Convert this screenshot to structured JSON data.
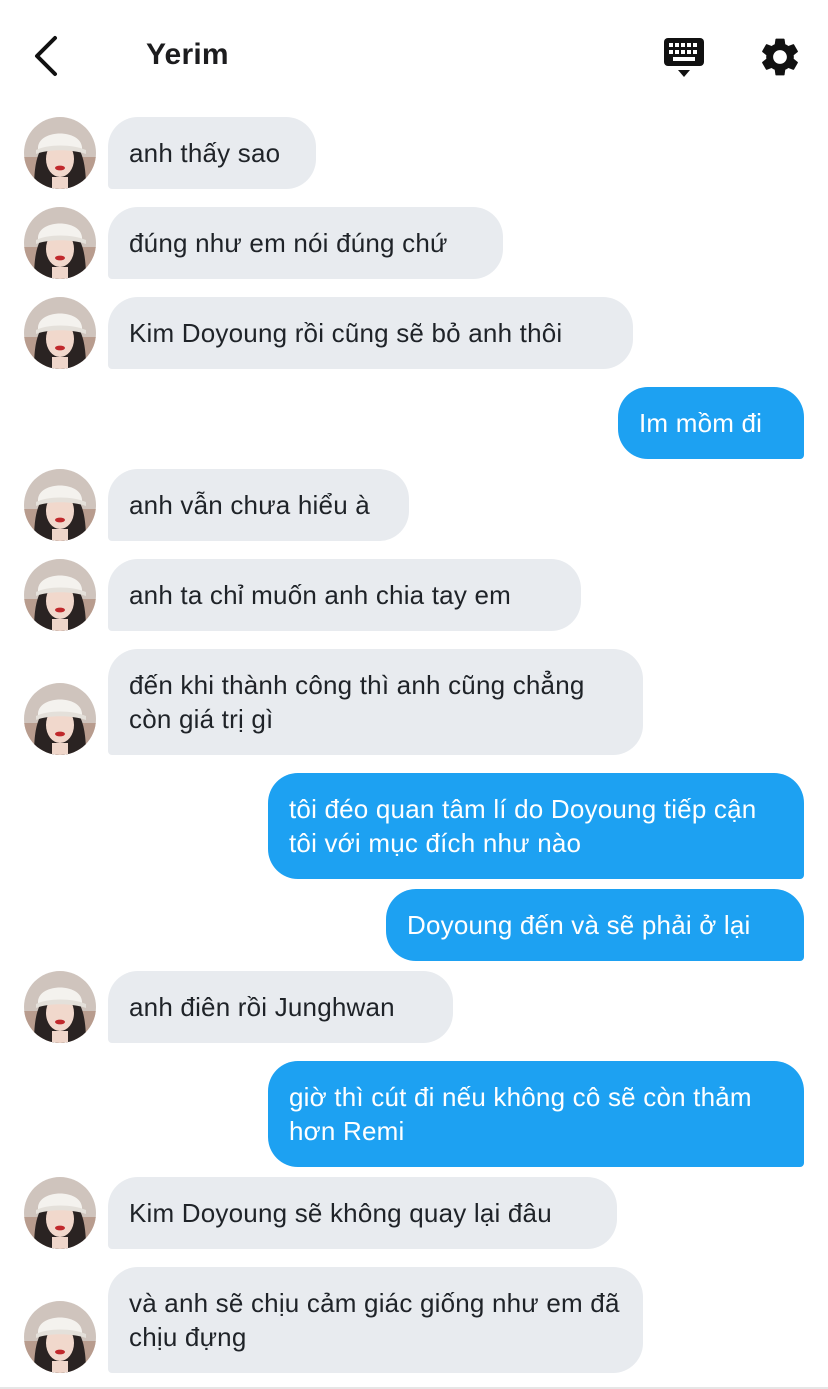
{
  "header": {
    "title": "Yerim",
    "back_icon": "chevron-left-icon",
    "keyboard_icon": "keyboard-icon",
    "settings_icon": "gear-icon"
  },
  "colors": {
    "incoming_bubble": "#e8ebef",
    "outgoing_bubble": "#1da1f2",
    "incoming_text": "#1f2328",
    "outgoing_text": "#ffffff"
  },
  "messages": [
    {
      "from": "Yerim",
      "text": "anh thấy sao"
    },
    {
      "from": "Yerim",
      "text": "đúng như em nói đúng chứ"
    },
    {
      "from": "Yerim",
      "text": "Kim Doyoung rồi cũng sẽ bỏ anh thôi"
    },
    {
      "from": "me",
      "text": "Im mồm đi"
    },
    {
      "from": "Yerim",
      "text": "anh vẫn chưa hiểu à"
    },
    {
      "from": "Yerim",
      "text": "anh ta chỉ muốn anh chia tay em"
    },
    {
      "from": "Yerim",
      "text": "đến khi thành công thì anh cũng chẳng còn giá trị gì"
    },
    {
      "from": "me",
      "text": "tôi đéo quan tâm lí do Doyoung tiếp cận tôi với mục đích như nào"
    },
    {
      "from": "me",
      "text": "Doyoung đến và sẽ phải ở lại"
    },
    {
      "from": "Yerim",
      "text": "anh điên rồi Junghwan"
    },
    {
      "from": "me",
      "text": "giờ thì cút đi nếu không cô sẽ còn thảm hơn Remi"
    },
    {
      "from": "Yerim",
      "text": "Kim Doyoung sẽ không quay lại đâu"
    },
    {
      "from": "Yerim",
      "text": "và anh sẽ chịu cảm giác giống như em đã chịu đựng"
    }
  ]
}
